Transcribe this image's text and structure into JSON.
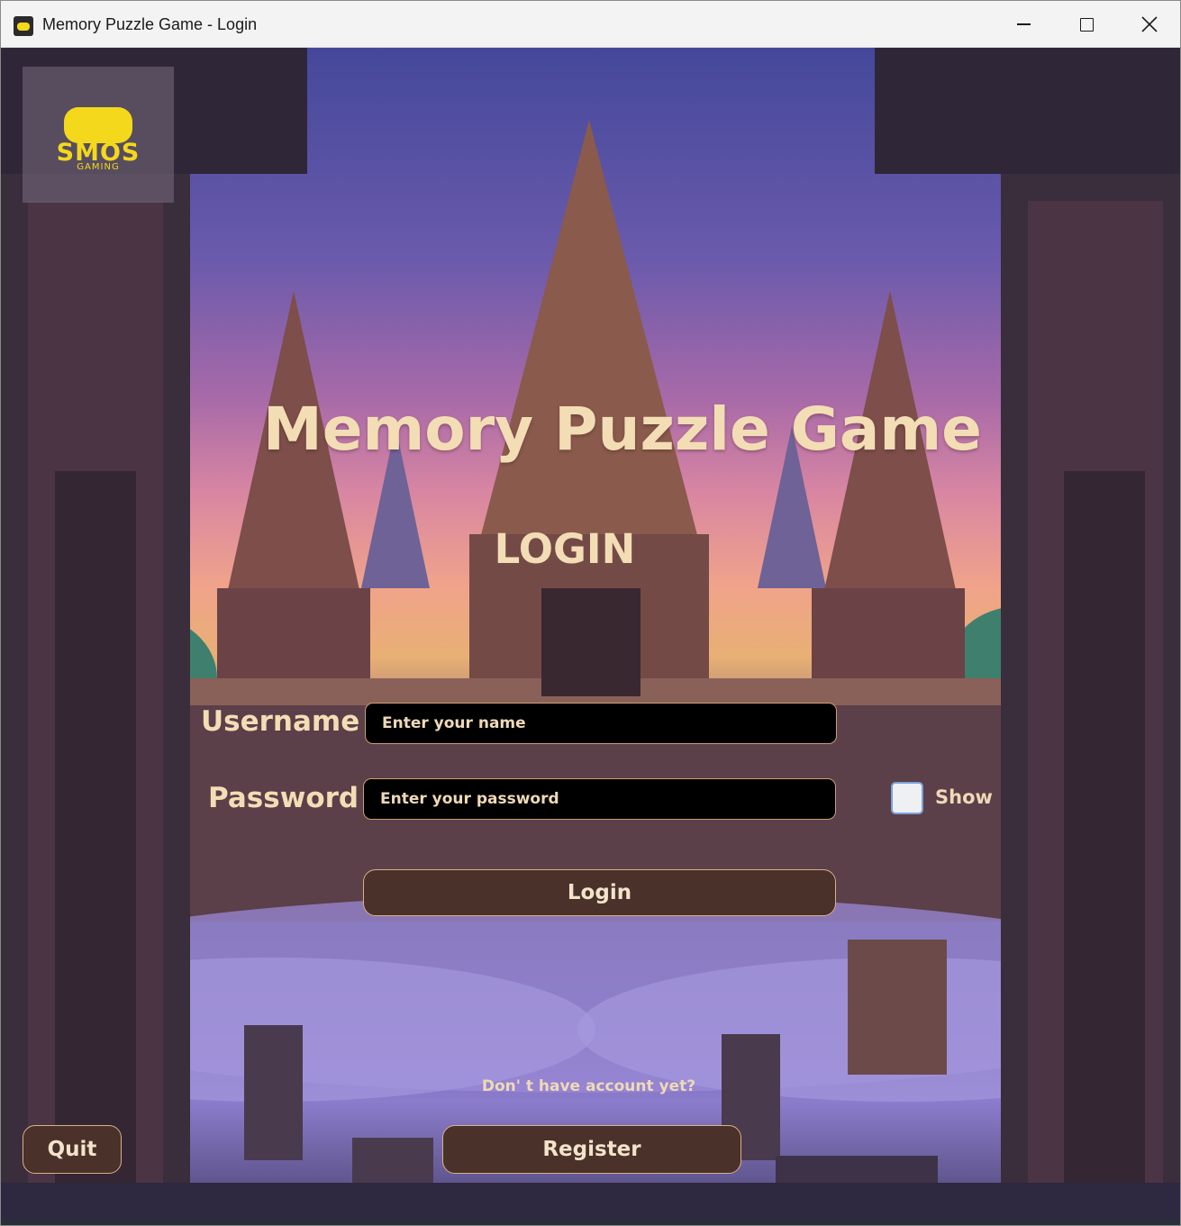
{
  "window": {
    "title": "Memory Puzzle Game - Login",
    "controls": {
      "minimize": "minimize",
      "maximize": "maximize",
      "close": "close"
    }
  },
  "logo": {
    "brand": "SMOS",
    "tagline": "GAMING",
    "color": "#f4d81c",
    "icon": "gamepad-icon"
  },
  "main": {
    "game_title": "Memory Puzzle Game",
    "heading": "LOGIN",
    "username_label": "Username",
    "username_placeholder": "Enter your name",
    "password_label": "Password",
    "password_placeholder": "Enter your password",
    "show_label": "Show",
    "show_checked": false,
    "login_button": "Login",
    "no_account_text": "Don' t have account yet?",
    "register_button": "Register",
    "quit_button": "Quit"
  },
  "colors": {
    "text_cream": "#f3ddb5",
    "button_bg": "#4a3129",
    "button_border": "#d8b08a",
    "field_bg": "#000000"
  }
}
